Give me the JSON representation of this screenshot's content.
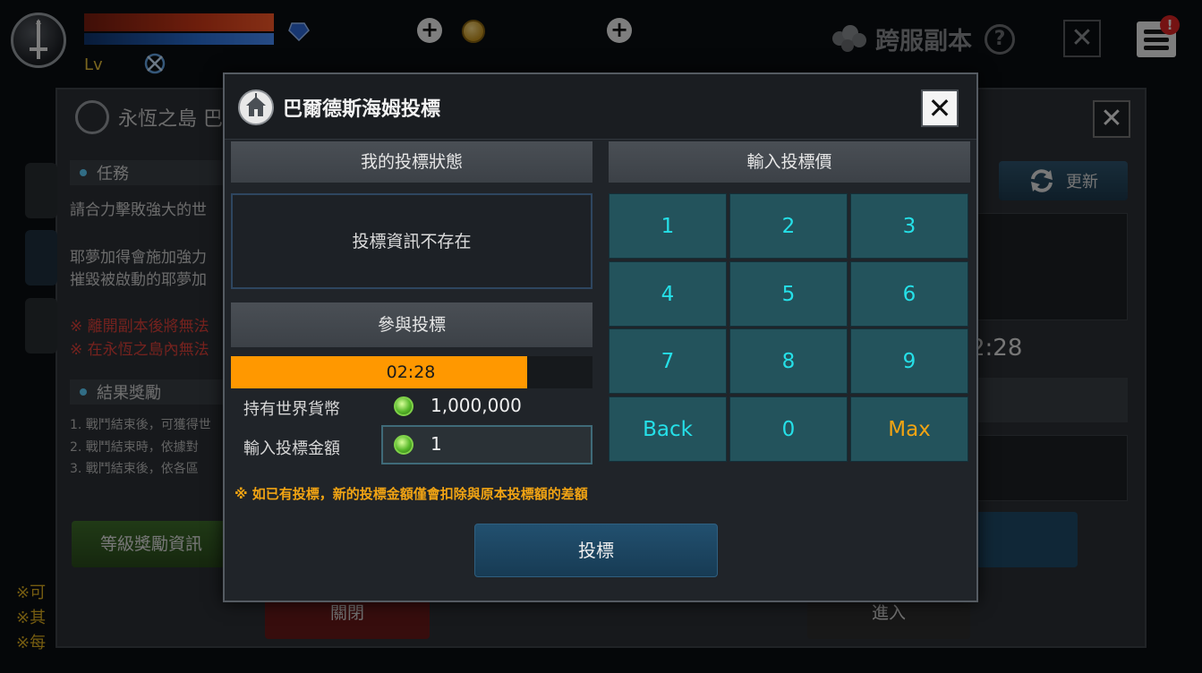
{
  "hud": {
    "level_label": "Lv",
    "cross_server_label": "跨服副本",
    "help_label": "?",
    "close_label": "✕",
    "alert_label": "!",
    "plus_label": "+",
    "colors": {
      "hp": "#d23a18",
      "mp": "#2a6fd6",
      "accent_gold": "#e8c23c"
    },
    "icons": [
      "sword-emblem-icon",
      "blue-gem-icon",
      "buff-icon",
      "plus-icon",
      "gold-coin-icon",
      "crowd-icon",
      "help-icon",
      "close-icon",
      "menu-icon"
    ]
  },
  "background": {
    "title": "永恆之島 巴",
    "close_label": "✕",
    "section_mission": "任務",
    "mission_lines": [
      "請合力擊敗強大的世",
      "耶夢加得會施加強力",
      "摧毀被啟動的耶夢加"
    ],
    "warning_lines": [
      "※ 離開副本後將無法",
      "※ 在永恆之島內無法"
    ],
    "section_reward": "結果獎勵",
    "reward_lines": [
      "1. 戰鬥結束後，可獲得世",
      "2. 戰鬥結束時，依據對",
      "3. 戰鬥結束後，依各區"
    ],
    "level_reward_button": "等級獎勵資訊",
    "refresh_button": "更新",
    "time_partial": "2:28",
    "close_button": "關閉",
    "enter_button": "進入",
    "footnotes": [
      "※可",
      "※其",
      "※每"
    ]
  },
  "modal": {
    "title": "巴爾德斯海姆投標",
    "close_label": "✕",
    "my_status_header": "我的投標狀態",
    "status_message": "投標資訊不存在",
    "participate_header": "參與投標",
    "timer_text": "02:28",
    "timer_progress": 0.82,
    "world_currency_label": "持有世界貨幣",
    "world_currency_value": "1,000,000",
    "bid_amount_label": "輸入投標金額",
    "bid_amount_value": "1",
    "notice": "※ 如已有投標，新的投標金額僅會扣除與原本投標額的差額",
    "bid_button": "投標",
    "keypad_header": "輸入投標價",
    "keypad": {
      "k1": "1",
      "k2": "2",
      "k3": "3",
      "k4": "4",
      "k5": "5",
      "k6": "6",
      "k7": "7",
      "k8": "8",
      "k9": "9",
      "back": "Back",
      "k0": "0",
      "max": "Max"
    },
    "colors": {
      "timer_fill": "#ff9800",
      "key_text": "#25e0e8",
      "notice": "#f2a413"
    }
  }
}
